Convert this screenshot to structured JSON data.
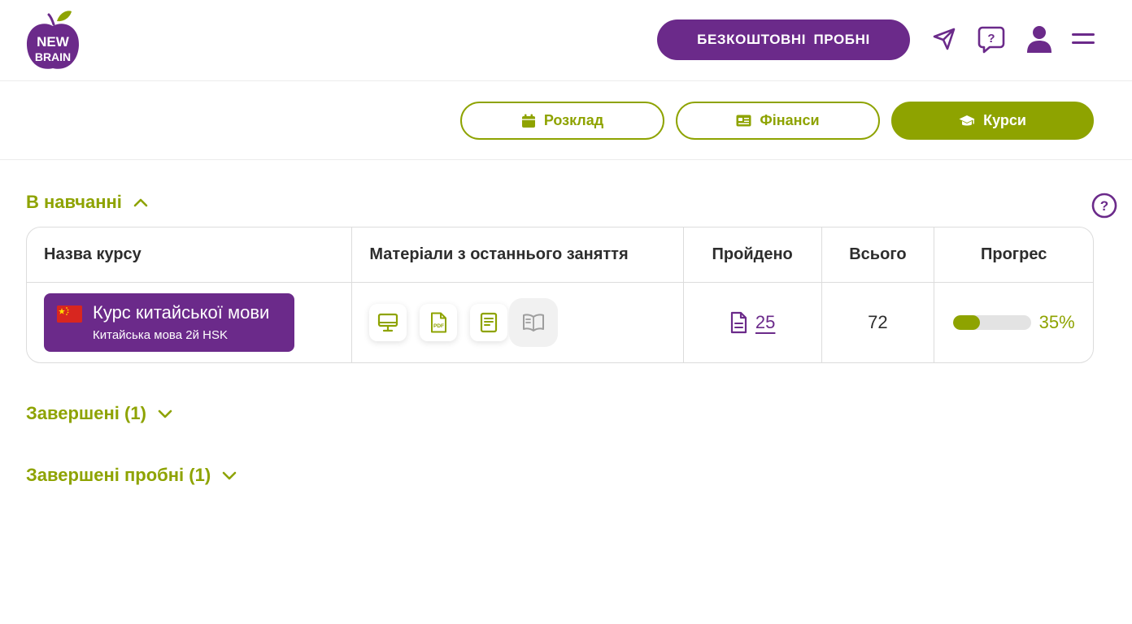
{
  "header": {
    "logo_text_top": "NEW",
    "logo_text_bottom": "BRAIN",
    "trial_button": "БЕЗКОШТОВНІ ПРОБНІ",
    "icons": [
      "send-icon",
      "help-chat-icon",
      "user-icon",
      "menu-icon"
    ],
    "help_chat_glyph": "?"
  },
  "tabs": [
    {
      "label": "Розклад",
      "icon": "calendar-icon",
      "active": false
    },
    {
      "label": "Фінанси",
      "icon": "wallet-icon",
      "active": false
    },
    {
      "label": "Курси",
      "icon": "graduation-cap-icon",
      "active": true
    }
  ],
  "sections": {
    "in_progress": "В навчанні",
    "completed": "Завершені (1)",
    "completed_trials": "Завершені пробні (1)",
    "help_glyph": "?"
  },
  "table": {
    "columns": [
      "Назва курсу",
      "Матеріали з останнього заняття",
      "Пройдено",
      "Всього",
      "Прогрес"
    ],
    "rows": [
      {
        "course_name": "Курс китайської мови",
        "course_subtitle": "Китайська мова 2й HSK",
        "flag": "china-flag-icon",
        "materials": [
          "presentation-icon",
          "pdf-icon",
          "notes-icon",
          "book-icon"
        ],
        "pdf_label": "PDF",
        "completed": "25",
        "total": "72",
        "progress_percent": 35,
        "progress_label": "35%"
      }
    ]
  },
  "colors": {
    "purple": "#6b2a8a",
    "green": "#8ea300",
    "border": "#dcdcdc"
  }
}
